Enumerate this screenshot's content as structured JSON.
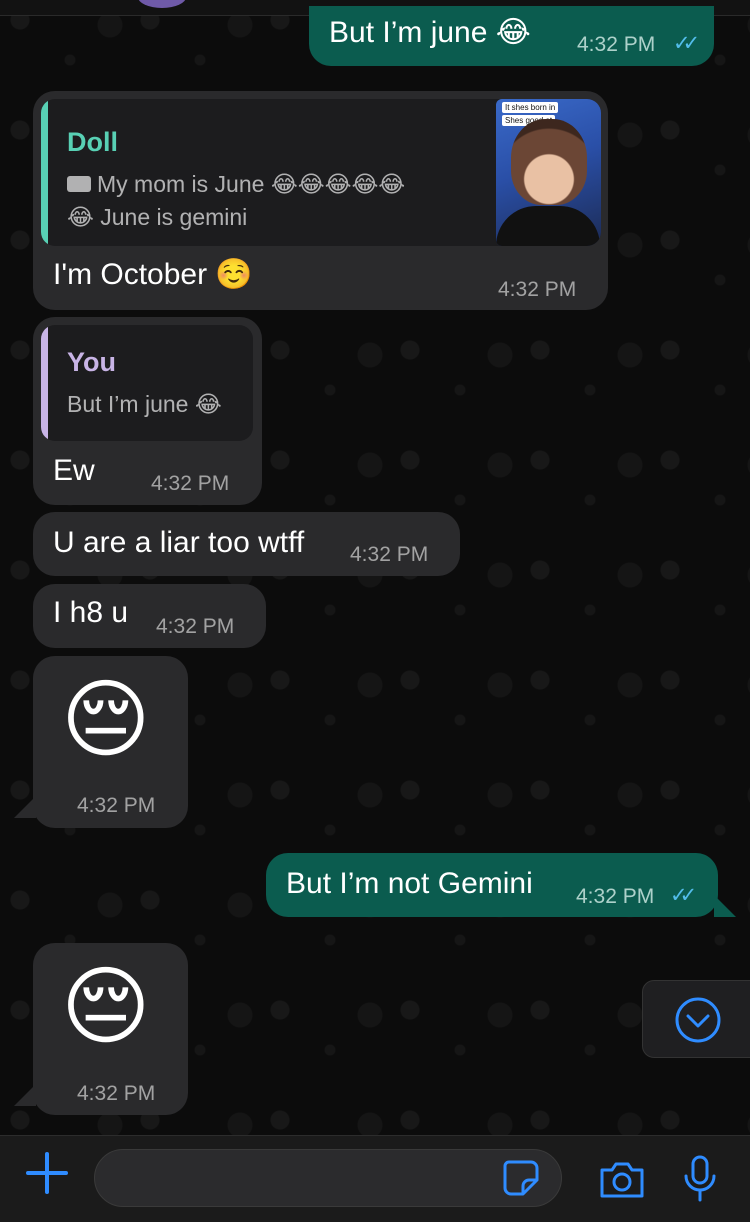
{
  "colors": {
    "accent": "#2f8cff",
    "read_ticks": "#53bdeb",
    "incoming_bubble": "#2a2a2c",
    "outgoing_bubble": "#0b5c4f",
    "doll_quote_bar": "#58d0b4",
    "you_quote_bar": "#c8b4e6",
    "doll_name": "#58d0b4",
    "you_name": "#c8b4e6"
  },
  "messages": {
    "m1": {
      "text": "But I’m june 😂",
      "time": "4:32 PM",
      "ticks": "✓✓"
    },
    "m2": {
      "quote_name": "Doll",
      "quote_line1": "My mom is June 😂😂😂😂😂",
      "quote_line2": "😂 June is gemini",
      "thumb_caption1": "It shes born in",
      "thumb_caption2": "Shes good at",
      "text": "I'm October ☺️",
      "time": "4:32 PM"
    },
    "m3": {
      "quote_name": "You",
      "quote_line1": "But I’m june 😂",
      "text": "Ew",
      "time": "4:32 PM"
    },
    "m4": {
      "text": "U are a liar too wtff",
      "time": "4:32 PM"
    },
    "m5": {
      "text": "I h8 u",
      "time": "4:32 PM"
    },
    "m6": {
      "emoji": "😔",
      "time": "4:32 PM"
    },
    "m7": {
      "text": "But I’m not Gemini",
      "time": "4:32 PM",
      "ticks": "✓✓"
    },
    "m8": {
      "emoji": "😔",
      "time": "4:32 PM"
    }
  },
  "input": {
    "value": "",
    "placeholder": ""
  },
  "icons": {
    "attach": "plus-icon",
    "sticker": "sticker-icon",
    "camera": "camera-icon",
    "mic": "microphone-icon",
    "scroll": "chevron-down-circle-icon",
    "video": "video-camera-icon"
  }
}
